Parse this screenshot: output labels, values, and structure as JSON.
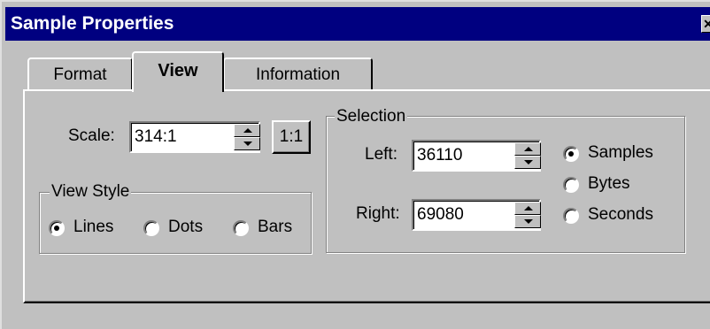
{
  "window": {
    "title": "Sample Properties",
    "close_glyph": "✕"
  },
  "tabs": [
    {
      "label": "Format",
      "active": false
    },
    {
      "label": "View",
      "active": true
    },
    {
      "label": "Information",
      "active": false
    }
  ],
  "scale": {
    "label": "Scale:",
    "value": "314:1",
    "reset_label": "1:1"
  },
  "view_style": {
    "group_label": "View Style",
    "options": [
      "Lines",
      "Dots",
      "Bars"
    ],
    "selected": "Lines"
  },
  "selection": {
    "group_label": "Selection",
    "left_label": "Left:",
    "left_value": "36110",
    "right_label": "Right:",
    "right_value": "69080",
    "units": [
      "Samples",
      "Bytes",
      "Seconds"
    ],
    "selected_unit": "Samples"
  }
}
